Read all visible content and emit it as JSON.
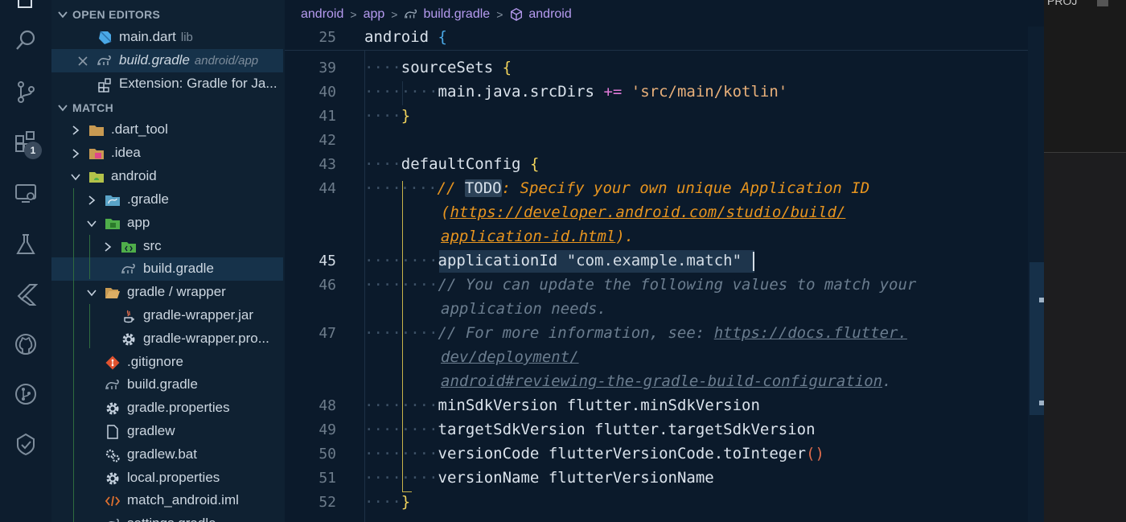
{
  "sidebar": {
    "open_editors_title": "OPEN EDITORS",
    "open_editors": [
      {
        "name": "main.dart",
        "sub": "lib"
      },
      {
        "name": "build.gradle",
        "sub": "android/app"
      },
      {
        "name": "Extension: Gradle for Ja...",
        "sub": ""
      }
    ],
    "project_title": "MATCH",
    "tree": [
      {
        "name": ".dart_tool"
      },
      {
        "name": ".idea"
      },
      {
        "name": "android"
      },
      {
        "name": ".gradle"
      },
      {
        "name": "app"
      },
      {
        "name": "src"
      },
      {
        "name": "build.gradle"
      },
      {
        "name": "gradle / wrapper"
      },
      {
        "name": "gradle-wrapper.jar"
      },
      {
        "name": "gradle-wrapper.pro..."
      },
      {
        "name": ".gitignore"
      },
      {
        "name": "build.gradle"
      },
      {
        "name": "gradle.properties"
      },
      {
        "name": "gradlew"
      },
      {
        "name": "gradlew.bat"
      },
      {
        "name": "local.properties"
      },
      {
        "name": "match_android.iml"
      },
      {
        "name": "settings.gradle"
      }
    ]
  },
  "activity": {
    "extensions_badge": "1"
  },
  "breadcrumb": {
    "items": [
      "android",
      "app",
      "build.gradle",
      "android"
    ]
  },
  "editor": {
    "lines": {
      "l25": "25",
      "l39": "39",
      "l40": "40",
      "l41": "41",
      "l42": "42",
      "l43": "43",
      "l44": "44",
      "l45": "45",
      "l46": "46",
      "l47": "47",
      "l48": "48",
      "l49": "49",
      "l50": "50",
      "l51": "51",
      "l52": "52"
    },
    "code": {
      "android": "android",
      "sourceSets": "sourceSets",
      "srcdirs": "main.java.srcDirs",
      "pluseq": "+=",
      "kotlin": "'src/main/kotlin'",
      "defaultConfig": "defaultConfig",
      "c44_pre": "// ",
      "c44_todo": "TODO",
      "c44_rest": ": Specify your own unique Application ID",
      "c44_link1": "https://developer.android.com/studio/build/",
      "c44_link2": "application-id.html",
      "c44_end": ").",
      "appid_key": "applicationId",
      "appid_val": "\"com.example.match\"",
      "c46a": "// You can update the following values to match your",
      "c46b": "application needs.",
      "c47_pre": "// For more information, see: ",
      "c47_link1": "https://docs.flutter.",
      "c47_link2": "dev/deployment/",
      "c47_link3": "android#reviewing-the-gradle-build-configuration",
      "c47_end": ".",
      "minsdk_key": "minSdkVersion",
      "minsdk_val": "flutter.minSdkVersion",
      "targetsdk_key": "targetSdkVersion",
      "targetsdk_val": "flutter.targetSdkVersion",
      "vcode_key": "versionCode",
      "vcode_val": "flutterVersionCode.toInteger",
      "vname_key": "versionName",
      "vname_val": "flutterVersionName"
    }
  },
  "right_panel": {
    "label": "PROJ"
  }
}
